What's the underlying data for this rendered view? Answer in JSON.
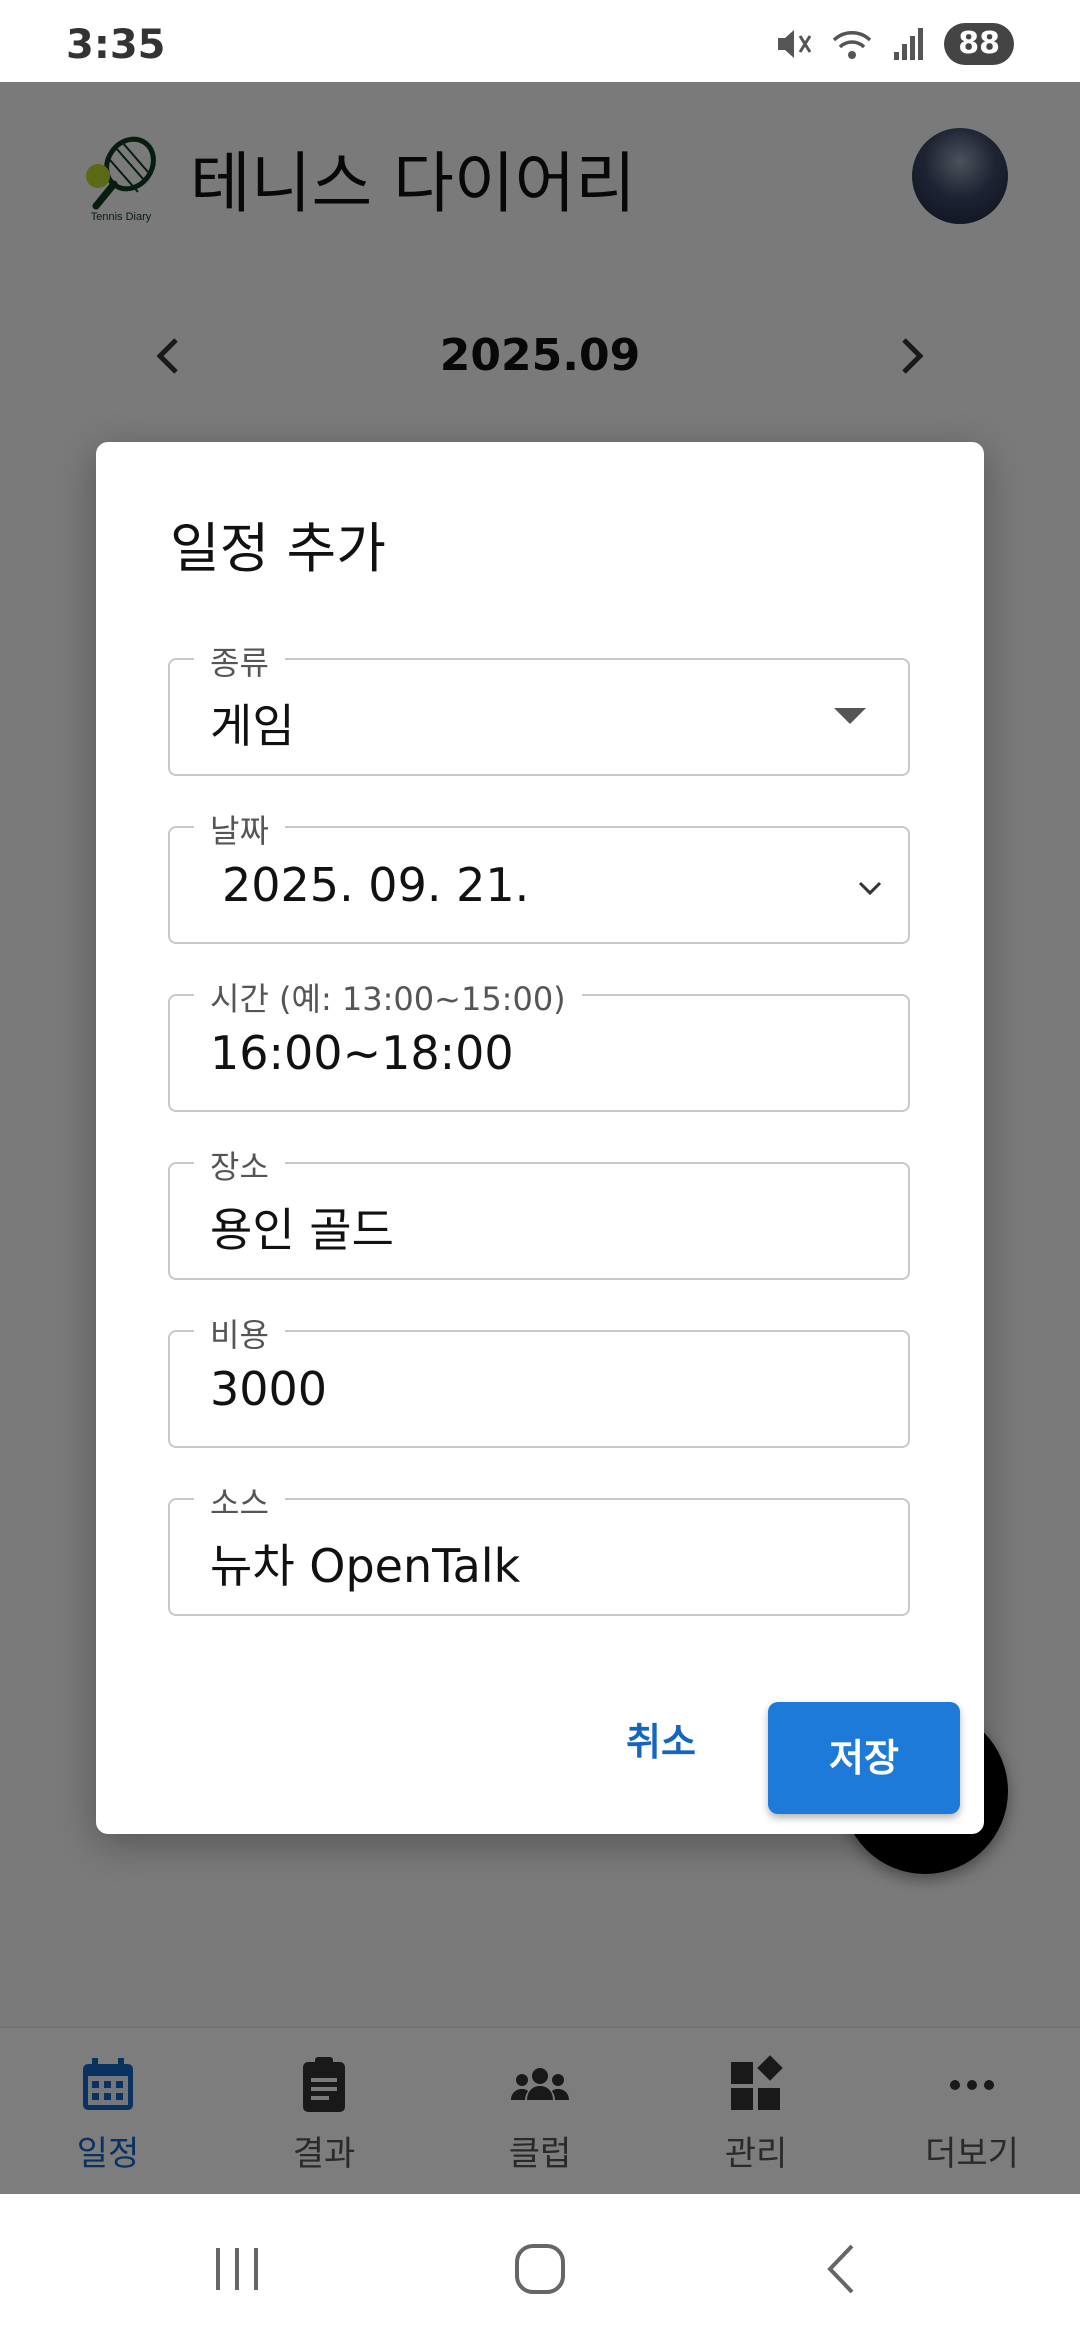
{
  "status_bar": {
    "time": "3:35",
    "battery": "88"
  },
  "app": {
    "title": "테니스 다이어리",
    "logo_text": "Tennis Diary",
    "month": "2025.09"
  },
  "dialog": {
    "title": "일정 추가",
    "fields": {
      "type": {
        "label": "종류",
        "value": "게임"
      },
      "date": {
        "label": "날짜",
        "value": "2025. 09. 21."
      },
      "time": {
        "label": "시간 (예: 13:00~15:00)",
        "value": "16:00~18:00"
      },
      "place": {
        "label": "장소",
        "value": "용인 골드"
      },
      "cost": {
        "label": "비용",
        "value": "3000"
      },
      "source": {
        "label": "소스",
        "value": "뉴차 OpenTalk"
      }
    },
    "cancel_label": "취소",
    "save_label": "저장"
  },
  "bottom_nav": {
    "items": [
      {
        "label": "일정",
        "icon": "calendar-icon",
        "active": true
      },
      {
        "label": "결과",
        "icon": "clipboard-icon",
        "active": false
      },
      {
        "label": "클럽",
        "icon": "group-icon",
        "active": false
      },
      {
        "label": "관리",
        "icon": "widgets-icon",
        "active": false
      },
      {
        "label": "더보기",
        "icon": "more-icon",
        "active": false
      }
    ]
  },
  "colors": {
    "primary": "#1e7ad9",
    "active_nav": "#1565c0",
    "scrim": "rgba(0,0,0,0.5)"
  }
}
